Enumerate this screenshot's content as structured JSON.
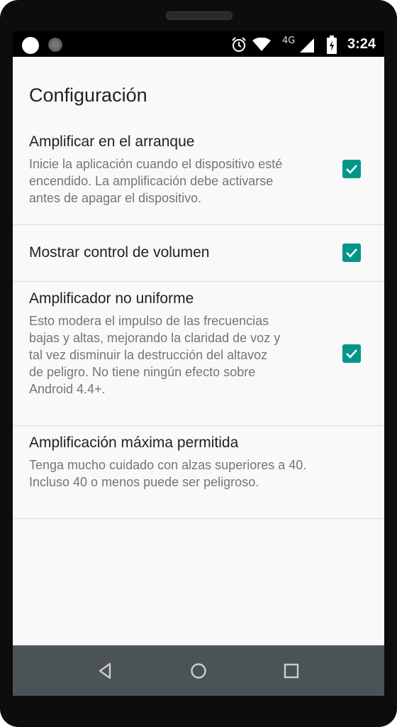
{
  "status_bar": {
    "network_label": "4G",
    "time": "3:24"
  },
  "page": {
    "title": "Configuración"
  },
  "preferences": [
    {
      "title": "Amplificar en el arranque",
      "summary_lines": [
        "Inicie la aplicación cuando el dispositivo esté",
        "encendido. La amplificación debe activarse",
        "antes de apagar el dispositivo."
      ],
      "checked": true
    },
    {
      "title": "Mostrar control de volumen",
      "summary_lines": [],
      "checked": true
    },
    {
      "title": "Amplificador no uniforme",
      "summary_lines": [
        "Esto modera el impulso de las frecuencias",
        "bajas y altas, mejorando la claridad de voz y",
        "tal vez disminuir la destrucción del altavoz",
        "de peligro. No tiene ningún efecto sobre",
        "Android 4.4+."
      ],
      "checked": true
    },
    {
      "title": "Amplificación máxima permitida",
      "summary_lines": [
        "Tenga mucho cuidado con alzas superiores a 40.",
        "Incluso 40 o menos puede ser peligroso."
      ]
    }
  ],
  "colors": {
    "accent": "#009688",
    "navbar": "#4c5357",
    "background": "#f9f9f9"
  },
  "icons": {
    "status": [
      "alarm-icon",
      "wifi-icon",
      "signal-icon",
      "battery-charging-icon"
    ],
    "nav": [
      "back-icon",
      "home-icon",
      "recents-icon"
    ]
  }
}
